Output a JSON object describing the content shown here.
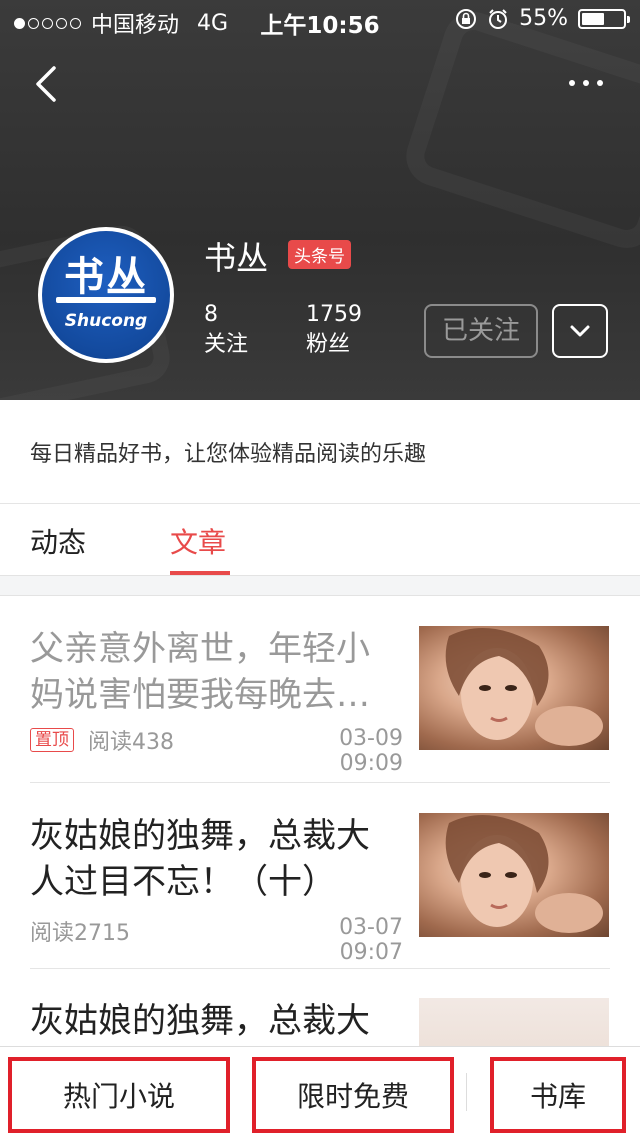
{
  "status_bar": {
    "carrier": "中国移动",
    "network": "4G",
    "time": "上午10:56",
    "battery": "55%",
    "battery_level": 0.55
  },
  "profile": {
    "name": "书丛",
    "badge": "头条号",
    "avatar_logo_main": "书丛",
    "avatar_logo_text": "Shucong",
    "following_count": "8",
    "following_label": "关注",
    "followers_count": "1759",
    "followers_label": "粉丝",
    "follow_button": "已关注",
    "bio": "每日精品好书，让您体验精品阅读的乐趣"
  },
  "tabs": [
    {
      "label": "动态",
      "active": false
    },
    {
      "label": "文章",
      "active": true
    }
  ],
  "articles": [
    {
      "title": "父亲意外离世，年轻小妈说害怕要我每晚去…",
      "pinned_label": "置顶",
      "reads": "阅读438",
      "date": "03-09 09:09"
    },
    {
      "title": "灰姑娘的独舞，总裁大人过目不忘！（十）",
      "reads": "阅读2715",
      "date": "03-07 09:07"
    },
    {
      "title": "灰姑娘的独舞，总裁大"
    }
  ],
  "bottom_bar": {
    "item1": "热门小说",
    "item2": "限时免费",
    "item3": "书库"
  },
  "colors": {
    "accent": "#e84a4a",
    "header_bg": "#333333",
    "highlight_border": "#e0202a"
  }
}
